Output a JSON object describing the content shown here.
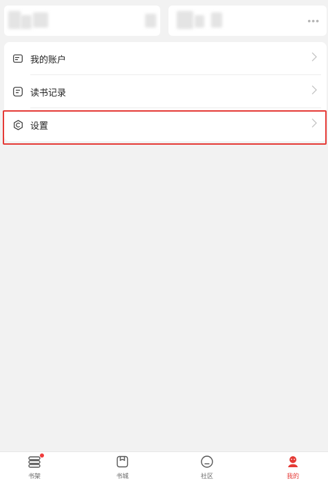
{
  "menu": {
    "items": [
      {
        "label": "我的账户",
        "icon": "wallet-icon"
      },
      {
        "label": "读书记录",
        "icon": "reading-record-icon"
      },
      {
        "label": "设置",
        "icon": "settings-icon"
      }
    ]
  },
  "top": {
    "more_label": "•••"
  },
  "tabs": [
    {
      "label": "书架",
      "icon": "bookshelf-icon",
      "badge": true
    },
    {
      "label": "书城",
      "icon": "bookstore-icon"
    },
    {
      "label": "社区",
      "icon": "community-icon"
    },
    {
      "label": "我的",
      "icon": "profile-icon",
      "active": true
    }
  ],
  "colors": {
    "accent": "#e53935",
    "background": "#f2f2f2"
  }
}
